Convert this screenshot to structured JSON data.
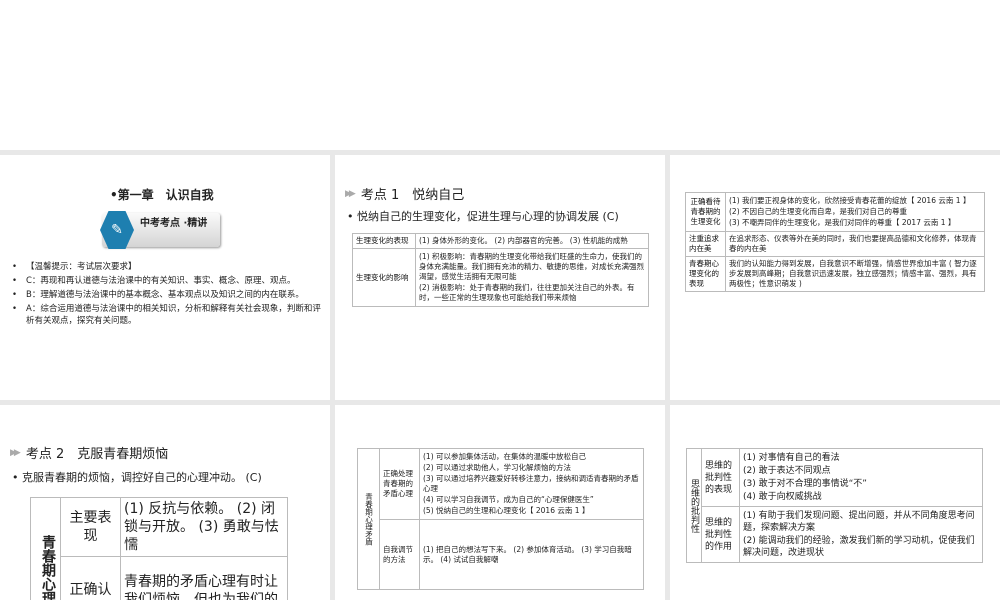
{
  "slide1": {
    "chapter": "•第一章　认识自我",
    "badge": "中考考点 ·精讲",
    "bullets": [
      "【温馨提示：考试层次要求】",
      "C：再现和再认道德与法治课中的有关知识、事实、概念、原理、观点。",
      "B：理解道德与法治课中的基本概念、基本观点以及知识之间的内在联系。",
      "A：综合运用道德与法治课中的相关知识，分析和解释有关社会现象，判断和评析有关观点，探究有关问题。"
    ]
  },
  "slide2": {
    "title": "考点 1　悦纳自己",
    "subtitle": "悦纳自己的生理变化，促进生理与心理的协调发展 (C)",
    "rows": [
      {
        "label": "生理变化的表现",
        "items": [
          "(1) 身体外形的变化。 (2) 内部器官的完善。 (3) 性机能的成熟"
        ]
      },
      {
        "label": "生理变化的影响",
        "items": [
          "(1) 积极影响：青春期的生理变化带给我们旺盛的生命力，使我们的身体充满能量。我们拥有充沛的精力、敏捷的思维，对成长充满强烈渴望，感觉生活拥有无限可能",
          "(2) 消极影响：处于青春期的我们，往往更加关注自己的外表。有时，一些正常的生理现象也可能给我们带来烦恼"
        ]
      }
    ]
  },
  "slide3": {
    "rows": [
      {
        "label": "正确看待青春期的生理变化",
        "items": [
          "(1) 我们要正视身体的变化，欣然接受青春花蕾的绽放【 2016 云南 1 】",
          "(2) 不因自己的生理变化而自卑，是我们对自己的尊重",
          "(3) 不嘲弄同伴的生理变化，是我们对同伴的尊重【 2017 云南 1 】"
        ]
      },
      {
        "label": "注重追求内在美",
        "items": [
          "在追求形态、仪表等外在美的同时，我们也要提高品德和文化修养，体现青春的内在美"
        ]
      },
      {
        "label": "青春期心理变化的表现",
        "items": [
          "我们的认知能力得到发展，自我意识不断增强，情感世界愈加丰富 ( 智力逐步发展到高峰期；自我意识迅速发展，独立感强烈；情感丰富、强烈，具有两极性；性意识萌发 )"
        ]
      }
    ]
  },
  "slide4": {
    "title": "考点 2　克服青春期烦恼",
    "subtitle": "克服青春期的烦恼，调控好自己的心理冲动。 (C)",
    "group": "青春期心理",
    "rows": [
      {
        "label": "主要表现",
        "text": "(1) 反抗与依赖。 (2) 闭锁与开放。 (3) 勇敢与怯懦"
      },
      {
        "label": "正确认识青春",
        "text": "青春期的矛盾心理有时让我们烦恼，但也为我们的成长提供了契机，积极面"
      }
    ]
  },
  "slide5": {
    "group": "青春期心理矛盾",
    "rows": [
      {
        "label": "正确处理青春期的矛盾心理",
        "items": [
          "(1) 可以参加集体活动，在集体的温暖中放松自己",
          "(2) 可以通过求助他人，学习化解烦恼的方法",
          "(3) 可以通过培养兴趣爱好转移注意力，接纳和调适青春期的矛盾心理",
          "(4) 可以学习自我调节，成为自己的“心理保健医生”",
          "(5) 悦纳自己的生理和心理变化【 2016 云南 1 】"
        ]
      },
      {
        "label": "自我调节的方法",
        "items": [
          "(1) 把自己的想法写下来。 (2) 参加体育活动。 (3) 学习自我暗示。 (4) 试试自我解嘲"
        ]
      }
    ]
  },
  "slide6": {
    "group": "思维的批判性",
    "rows": [
      {
        "label": "思维的批判性的表现",
        "items": [
          "(1) 对事情有自己的看法",
          "(2) 敢于表达不同观点",
          "(3) 敢于对不合理的事情说“不”",
          "(4) 敢于向权威挑战"
        ]
      },
      {
        "label": "思维的批判性的作用",
        "items": [
          "(1) 有助于我们发现问题、提出问题，并从不同角度思考问题，探索解决方案",
          "(2) 能调动我们的经验，激发我们新的学习动机，促使我们解决问题，改进现状"
        ]
      }
    ]
  }
}
